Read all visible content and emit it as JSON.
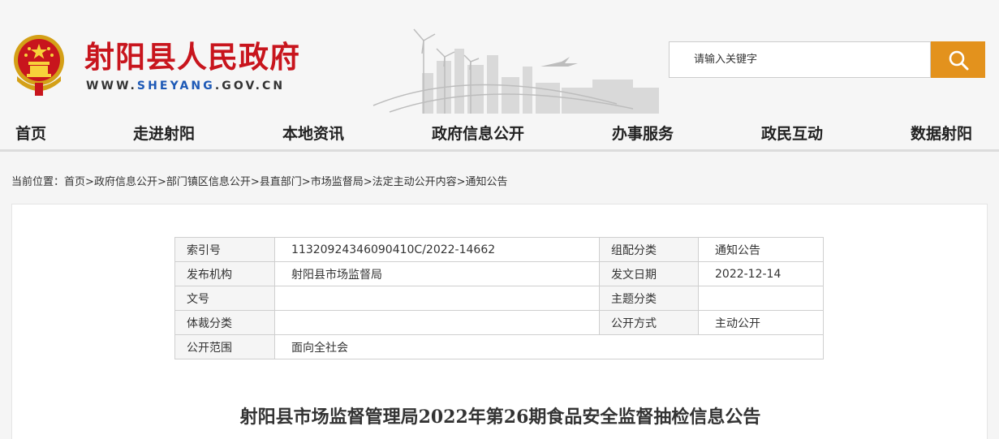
{
  "header": {
    "site_title": "射阳县人民政府",
    "url_prefix": "WWW.",
    "url_highlight": "SHEYANG",
    "url_suffix": ".GOV.CN"
  },
  "search": {
    "placeholder": "请输入关键字"
  },
  "nav": {
    "items": [
      "首页",
      "走进射阳",
      "本地资讯",
      "政府信息公开",
      "办事服务",
      "政民互动",
      "数据射阳"
    ]
  },
  "breadcrumb": {
    "label": "当前位置：",
    "items": [
      "首页",
      "政府信息公开",
      "部门镇区信息公开",
      "县直部门",
      "市场监督局",
      "法定主动公开内容",
      "通知公告"
    ],
    "separator": ">"
  },
  "meta_table": {
    "index_key": "索引号",
    "index_val": "11320924346090410C/2022-14662",
    "group_key": "组配分类",
    "group_val": "通知公告",
    "org_key": "发布机构",
    "org_val": "射阳县市场监督局",
    "date_key": "发文日期",
    "date_val": "2022-12-14",
    "docno_key": "文号",
    "docno_val": "",
    "topic_key": "主题分类",
    "topic_val": "",
    "genre_key": "体裁分类",
    "genre_val": "",
    "mode_key": "公开方式",
    "mode_val": "主动公开",
    "scope_key": "公开范围",
    "scope_val": "面向全社会"
  },
  "article": {
    "title": "射阳县市场监督管理局2022年第26期食品安全监督抽检信息公告"
  },
  "colors": {
    "brand_red": "#c8151d",
    "search_orange": "#e3921d",
    "url_blue": "#1d59b6"
  }
}
